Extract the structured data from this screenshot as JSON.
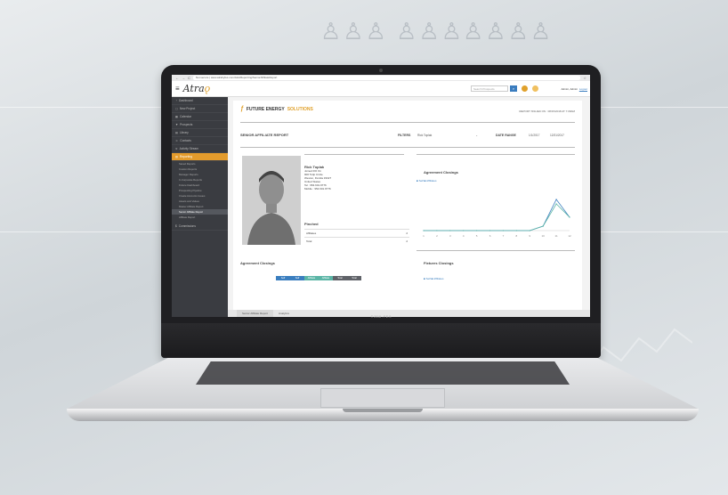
{
  "browser": {
    "security_label": "Not secure",
    "url": "www.atrabyfes.com/Atra/Reporting/SeniorAffiliateReport"
  },
  "header": {
    "logo_text": "Atra",
    "search_placeholder": "Search Prospects",
    "user_name": "Admin, Admin",
    "logout_label": "Logout"
  },
  "sidebar": {
    "items": [
      {
        "label": "Dashboard"
      },
      {
        "label": "New Project"
      },
      {
        "label": "Calendar"
      },
      {
        "label": "Prospects"
      },
      {
        "label": "Library"
      },
      {
        "label": "Contacts"
      },
      {
        "label": "Activity Stream"
      },
      {
        "label": "Reporting"
      }
    ],
    "subitems": [
      {
        "label": "Saved Reports"
      },
      {
        "label": "Custom Reports"
      },
      {
        "label": "Manager Reports"
      },
      {
        "label": "C-Corporate Reports"
      },
      {
        "label": "Fixture Dashboard"
      },
      {
        "label": "Prospecting Pipeline"
      },
      {
        "label": "Create Accounts Issues"
      },
      {
        "label": "Assets and Values"
      },
      {
        "label": "Master Affiliate Report"
      },
      {
        "label": "Senior Affiliate Report"
      },
      {
        "label": "Affiliate Report"
      }
    ],
    "commissions_label": "Commissions"
  },
  "report": {
    "brand_name": "FUTURE ENERGY",
    "brand_accent": "SOLUTIONS",
    "issued_text": "REPORT ISSUED ON : 08/15/2018 AT 7:08AM",
    "title": "SENIOR AFFILIATE REPORT",
    "filters_label": "FILTERS",
    "filter_value": "Rick Toplak",
    "date_range_label": "DATE RANGE",
    "date_from": "1/1/2017",
    "date_to": "12/31/2017",
    "contact": {
      "name": "Rick Toplak",
      "line1": "Joined RO On",
      "line2": "900 Tulip Circle",
      "line3": "Weston, Florida 33327",
      "line4": "United States",
      "line5": "Tel : 954.601.9776",
      "line6": "Mobile : 954.601.9776"
    },
    "pinched": {
      "title": "Pinched",
      "rows": [
        {
          "label": "Affiliates",
          "value": "2"
        },
        {
          "label": "Total",
          "value": "2"
        }
      ]
    },
    "agreement_closings_title": "Agreement Closings",
    "agreement_closings_title_2": "Agreement Closings",
    "fixtures_closings_title": "Fixtures Closings",
    "legend_label": "Self",
    "legend_label_2": "Affiliates",
    "mini_bars": [
      "Self",
      "Self",
      "Affiliate",
      "Affiliate",
      "Total",
      "Total"
    ]
  },
  "footer": {
    "tabs": [
      "Senior Affiliate Report",
      "Analytics"
    ],
    "copyright": "© 2018 - F.E.S"
  },
  "chart_data": {
    "type": "line",
    "categories": [
      "1",
      "2",
      "3",
      "4",
      "5",
      "6",
      "7",
      "8",
      "9",
      "10",
      "11",
      "12"
    ],
    "series": [
      {
        "name": "Self",
        "values": [
          0,
          0,
          0,
          0,
          0,
          0,
          0,
          0,
          0,
          1,
          7,
          3
        ]
      },
      {
        "name": "Affiliates",
        "values": [
          0,
          0,
          0,
          0,
          0,
          0,
          0,
          0,
          0,
          1,
          6,
          3
        ]
      }
    ],
    "ylim": [
      0,
      10
    ],
    "colors": [
      "#3a7ebf",
      "#5bb5a6"
    ]
  }
}
